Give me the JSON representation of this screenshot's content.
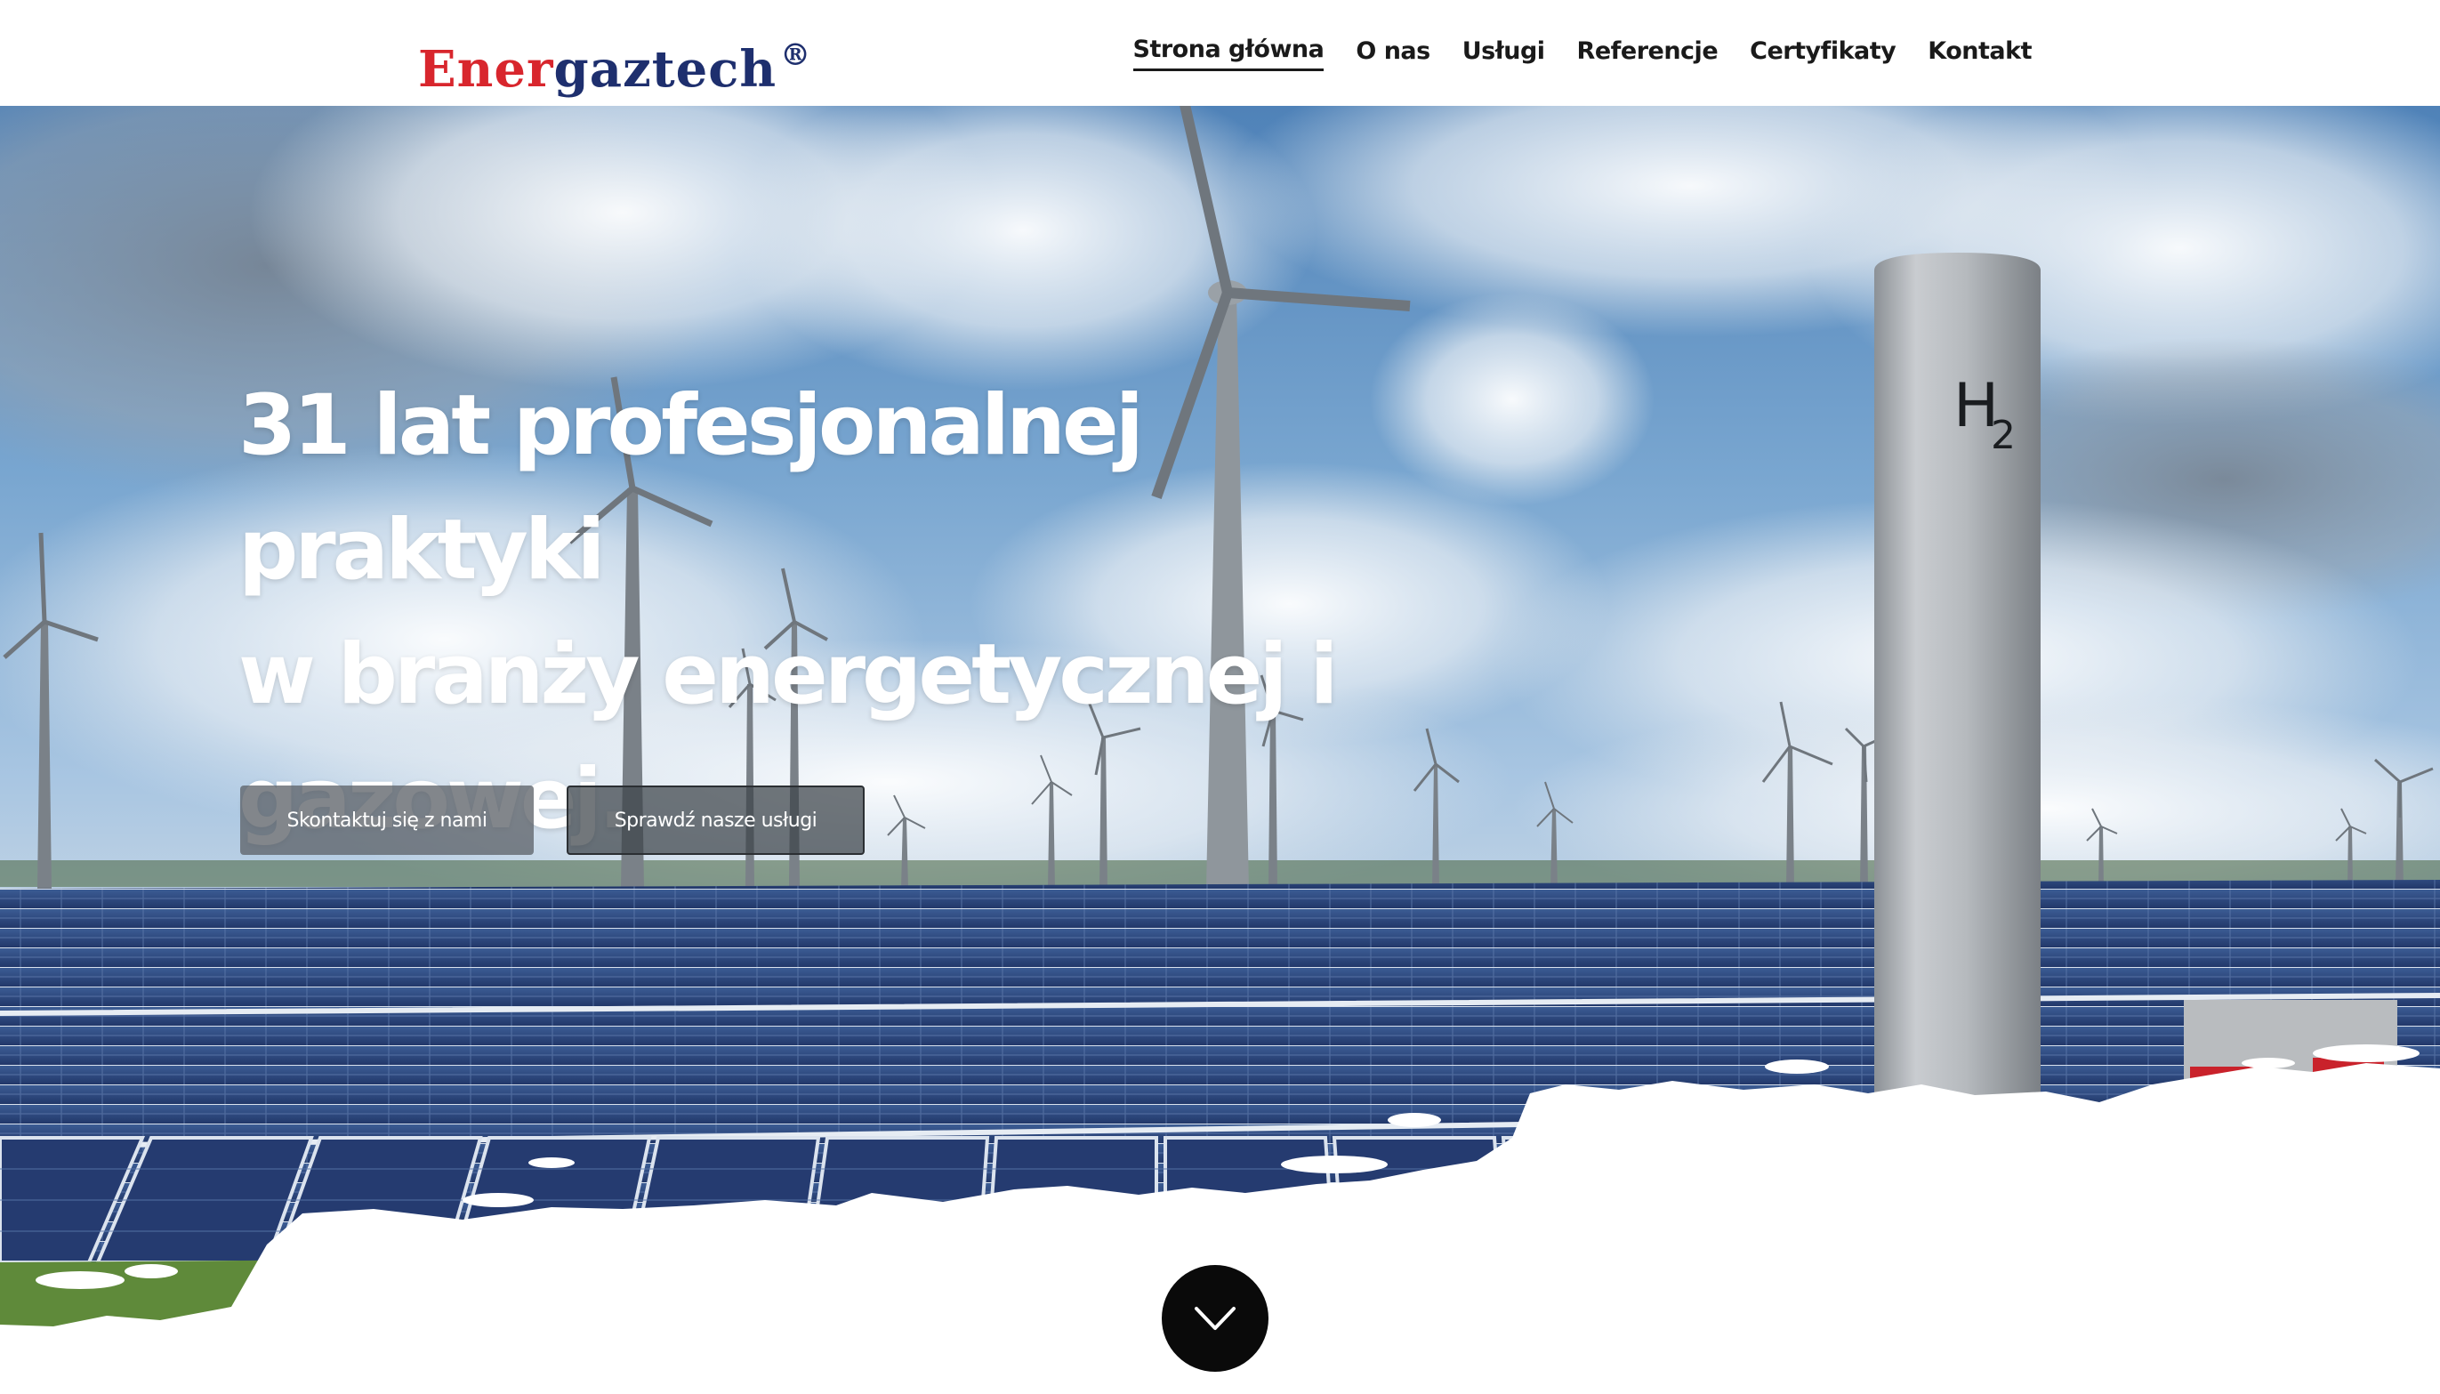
{
  "brand": {
    "logo_part1": "Ener",
    "logo_part2": "gaztech",
    "logo_registered": "®",
    "red": "#d8262d",
    "navy": "#1e2f6e"
  },
  "nav": {
    "items": [
      {
        "label": "Strona główna",
        "active": true
      },
      {
        "label": "O nas",
        "active": false
      },
      {
        "label": "Usługi",
        "active": false
      },
      {
        "label": "Referencje",
        "active": false
      },
      {
        "label": "Certyfikaty",
        "active": false
      },
      {
        "label": "Kontakt",
        "active": false
      }
    ]
  },
  "hero": {
    "headline_line1": "31 lat profesjonalnej praktyki",
    "headline_line2": "w branży energetycznej i",
    "headline_line3": "gazowej.",
    "cta_contact": "Skontaktuj się z nami",
    "cta_services": "Sprawdź nasze usługi",
    "tank_label": "H",
    "tank_label_sub": "2"
  },
  "scroll": {
    "icon": "chevron-down-icon"
  }
}
